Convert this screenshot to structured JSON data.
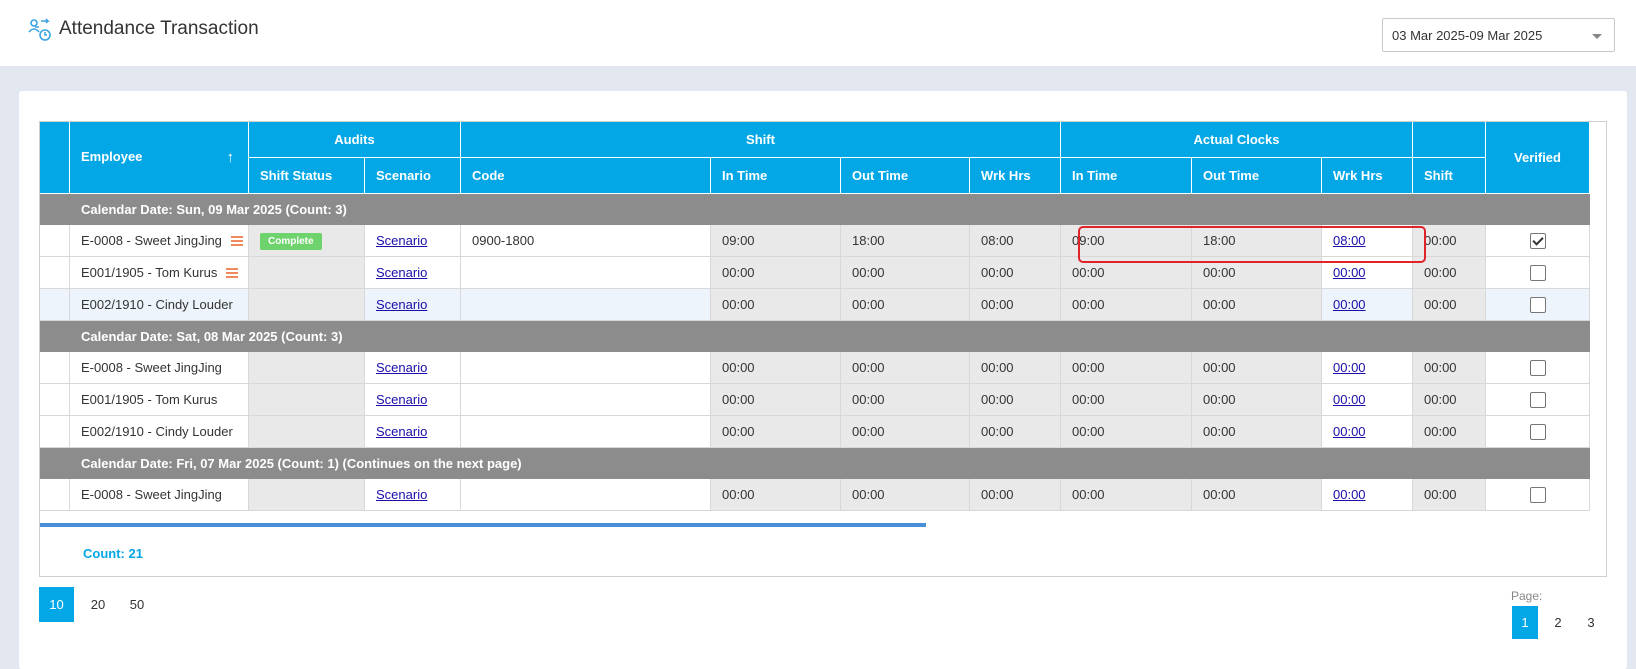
{
  "header": {
    "title": "Attendance Transaction",
    "date_range": "03 Mar 2025-09 Mar 2025"
  },
  "grid": {
    "headers": {
      "employee": "Employee",
      "audits": "Audits",
      "shift": "Shift",
      "actual_clocks": "Actual Clocks",
      "verified": "Verified",
      "shift_status": "Shift Status",
      "scenario": "Scenario",
      "code": "Code",
      "shift_in": "In Time",
      "shift_out": "Out Time",
      "shift_wrk": "Wrk Hrs",
      "act_in": "In Time",
      "act_out": "Out Time",
      "act_wrk": "Wrk Hrs",
      "act_shift": "Shift"
    },
    "groups": [
      {
        "label": "Calendar Date: Sun, 09 Mar 2025 (Count: 3)",
        "rows": [
          {
            "employee": "E-0008 - Sweet JingJing",
            "status": "Complete",
            "scenario": "Scenario",
            "code": "0900-1800",
            "s_in": "09:00",
            "s_out": "18:00",
            "s_wrk": "08:00",
            "a_in": "09:00",
            "a_out": "18:00",
            "a_wrk": "08:00",
            "a_shift": "00:00"
          },
          {
            "employee": "E001/1905 - Tom Kurus",
            "status": "",
            "scenario": "Scenario",
            "code": "",
            "s_in": "00:00",
            "s_out": "00:00",
            "s_wrk": "00:00",
            "a_in": "00:00",
            "a_out": "00:00",
            "a_wrk": "00:00",
            "a_shift": "00:00"
          },
          {
            "employee": "E002/1910 - Cindy Louder",
            "status": "",
            "scenario": "Scenario",
            "code": "",
            "s_in": "00:00",
            "s_out": "00:00",
            "s_wrk": "00:00",
            "a_in": "00:00",
            "a_out": "00:00",
            "a_wrk": "00:00",
            "a_shift": "00:00"
          }
        ]
      },
      {
        "label": "Calendar Date: Sat, 08 Mar 2025 (Count: 3)",
        "rows": [
          {
            "employee": "E-0008 - Sweet JingJing",
            "status": "",
            "scenario": "Scenario",
            "code": "",
            "s_in": "00:00",
            "s_out": "00:00",
            "s_wrk": "00:00",
            "a_in": "00:00",
            "a_out": "00:00",
            "a_wrk": "00:00",
            "a_shift": "00:00"
          },
          {
            "employee": "E001/1905 - Tom Kurus",
            "status": "",
            "scenario": "Scenario",
            "code": "",
            "s_in": "00:00",
            "s_out": "00:00",
            "s_wrk": "00:00",
            "a_in": "00:00",
            "a_out": "00:00",
            "a_wrk": "00:00",
            "a_shift": "00:00"
          },
          {
            "employee": "E002/1910 - Cindy Louder",
            "status": "",
            "scenario": "Scenario",
            "code": "",
            "s_in": "00:00",
            "s_out": "00:00",
            "s_wrk": "00:00",
            "a_in": "00:00",
            "a_out": "00:00",
            "a_wrk": "00:00",
            "a_shift": "00:00"
          }
        ]
      },
      {
        "label": "Calendar Date: Fri, 07 Mar 2025 (Count: 1) (Continues on the next page)",
        "rows": [
          {
            "employee": "E-0008 - Sweet JingJing",
            "status": "",
            "scenario": "Scenario",
            "code": "",
            "s_in": "00:00",
            "s_out": "00:00",
            "s_wrk": "00:00",
            "a_in": "00:00",
            "a_out": "00:00",
            "a_wrk": "00:00",
            "a_shift": "00:00"
          }
        ]
      }
    ],
    "count_label": "Count: 21"
  },
  "pagination": {
    "page_sizes": [
      "10",
      "20",
      "50"
    ],
    "page_label": "Page:",
    "pages": [
      "1",
      "2",
      "3"
    ]
  },
  "colors": {
    "accent": "#04a7e6",
    "group_bg": "#8c8c8c",
    "complete": "#6fd36d",
    "highlight": "#e0232a"
  }
}
